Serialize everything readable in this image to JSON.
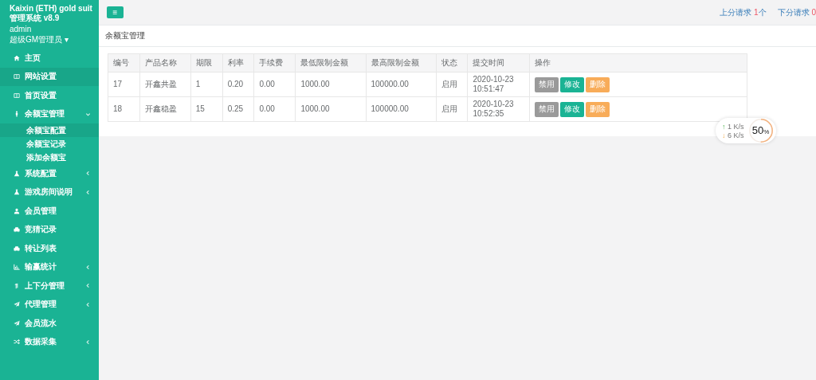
{
  "sidebar": {
    "app_title": "Kaixin (ETH) gold suit管理系统 v8.9",
    "user": "admin",
    "role": "超级GM管理员",
    "role_caret": "▾",
    "items": [
      {
        "label": "主页",
        "kind": "home",
        "selected": false
      },
      {
        "label": "网站设置",
        "kind": "columns",
        "selected": true
      },
      {
        "label": "首页设置",
        "kind": "columns",
        "selected": false
      },
      {
        "label": "余额宝管理",
        "kind": "person",
        "selected": false,
        "expanded": true,
        "children": [
          {
            "label": "余额宝配置",
            "selected": true
          },
          {
            "label": "余额宝记录",
            "selected": false
          },
          {
            "label": "添加余额宝",
            "selected": false
          }
        ]
      },
      {
        "label": "系统配置",
        "kind": "flask",
        "selected": false,
        "expanded": false
      },
      {
        "label": "游戏房间说明",
        "kind": "flask",
        "selected": false,
        "expanded": false
      },
      {
        "label": "会员管理",
        "kind": "user",
        "selected": false
      },
      {
        "label": "竞猜记录",
        "kind": "car",
        "selected": false
      },
      {
        "label": "转让列表",
        "kind": "car",
        "selected": false
      },
      {
        "label": "输赢统计",
        "kind": "chart",
        "selected": false,
        "expanded": false
      },
      {
        "label": "上下分管理",
        "kind": "updown",
        "selected": false,
        "expanded": false
      },
      {
        "label": "代理管理",
        "kind": "plane",
        "selected": false,
        "expanded": false
      },
      {
        "label": "会员流水",
        "kind": "plane",
        "selected": false
      },
      {
        "label": "数据采集",
        "kind": "shuffle",
        "selected": false,
        "expanded": false
      }
    ]
  },
  "topbar": {
    "menu_button": "≡",
    "requests": [
      {
        "label": "上分请求",
        "count": "1",
        "unit": "个"
      },
      {
        "label": "下分请求",
        "count": "0"
      }
    ]
  },
  "page": {
    "title": "余额宝管理",
    "table": {
      "columns": [
        "编号",
        "产品名称",
        "期限",
        "利率",
        "手续费",
        "最低限制金额",
        "最高限制金额",
        "状态",
        "提交时间",
        "操作"
      ],
      "rows": [
        {
          "cells": [
            "17",
            "开鑫共盈",
            "1",
            "0.20",
            "0.00",
            "1000.00",
            "100000.00",
            "启用"
          ],
          "time": [
            "2020-10-23",
            "10:51:47"
          ],
          "actions": [
            {
              "label": "禁用",
              "kind": "disabled"
            },
            {
              "label": "修改",
              "kind": "edit"
            },
            {
              "label": "删除",
              "kind": "delete"
            }
          ]
        },
        {
          "cells": [
            "18",
            "开鑫稳盈",
            "15",
            "0.25",
            "0.00",
            "1000.00",
            "100000.00",
            "启用"
          ],
          "time": [
            "2020-10-23",
            "10:52:35"
          ],
          "actions": [
            {
              "label": "禁用",
              "kind": "disabled"
            },
            {
              "label": "修改",
              "kind": "edit"
            },
            {
              "label": "删除",
              "kind": "delete"
            }
          ]
        }
      ]
    }
  },
  "speed_widget": {
    "upload_arrow": "↑",
    "upload": "1",
    "upload_unit": "K/s",
    "download_arrow": "↓",
    "download": "6",
    "download_unit": "K/s",
    "percent": "50",
    "percent_sign": "%",
    "level": 0.5
  }
}
